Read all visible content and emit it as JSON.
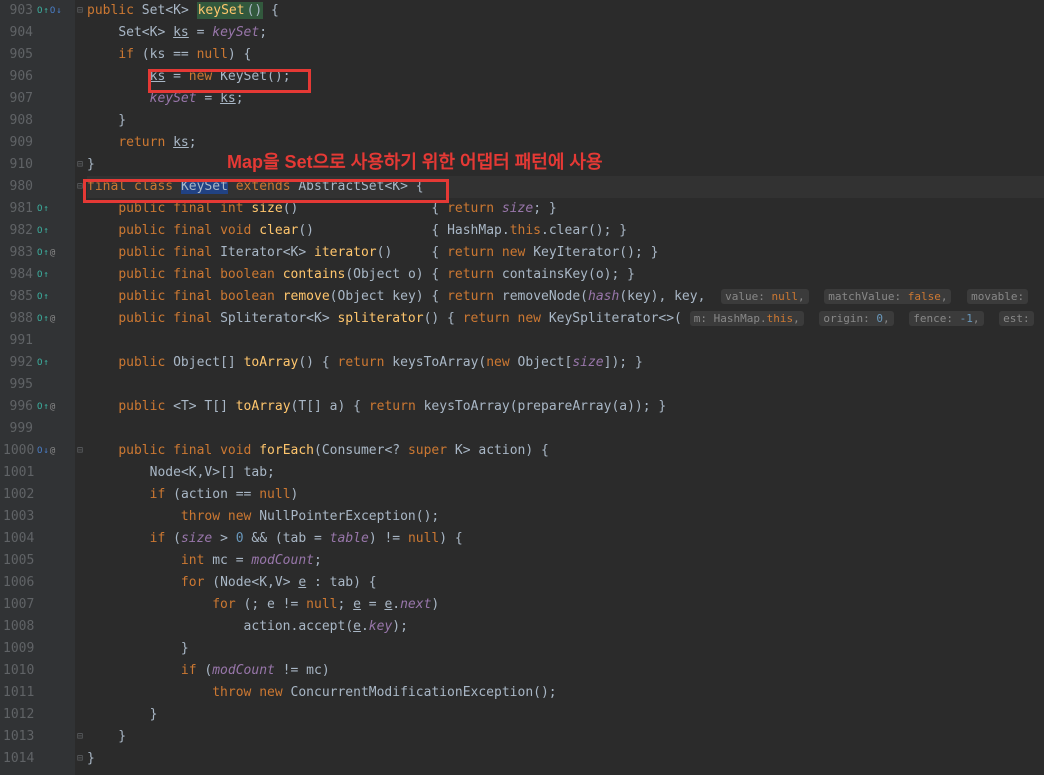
{
  "annotation": "Map을 Set으로 사용하기 위한 어댑터 패턴에 사용",
  "gutter": [
    {
      "n": "903",
      "markers": [
        "o-teal",
        "arrow-teal",
        "o-blue",
        "arrow-blue"
      ]
    },
    {
      "n": "904",
      "markers": []
    },
    {
      "n": "905",
      "markers": []
    },
    {
      "n": "906",
      "markers": []
    },
    {
      "n": "907",
      "markers": []
    },
    {
      "n": "908",
      "markers": []
    },
    {
      "n": "909",
      "markers": []
    },
    {
      "n": "910",
      "markers": []
    },
    {
      "n": "980",
      "markers": []
    },
    {
      "n": "981",
      "markers": [
        "o-teal",
        "arrow-teal"
      ]
    },
    {
      "n": "982",
      "markers": [
        "o-teal",
        "arrow-teal"
      ]
    },
    {
      "n": "983",
      "markers": [
        "o-teal",
        "arrow-teal",
        "at"
      ]
    },
    {
      "n": "984",
      "markers": [
        "o-teal",
        "arrow-teal"
      ]
    },
    {
      "n": "985",
      "markers": [
        "o-teal",
        "arrow-teal"
      ]
    },
    {
      "n": "988",
      "markers": [
        "o-teal",
        "arrow-teal",
        "at"
      ]
    },
    {
      "n": "991",
      "markers": []
    },
    {
      "n": "992",
      "markers": [
        "o-teal",
        "arrow-teal"
      ]
    },
    {
      "n": "995",
      "markers": []
    },
    {
      "n": "996",
      "markers": [
        "o-teal",
        "arrow-teal",
        "at"
      ]
    },
    {
      "n": "999",
      "markers": []
    },
    {
      "n": "1000",
      "markers": [
        "o-blue",
        "arrow-blue",
        "at"
      ]
    },
    {
      "n": "1001",
      "markers": []
    },
    {
      "n": "1002",
      "markers": []
    },
    {
      "n": "1003",
      "markers": []
    },
    {
      "n": "1004",
      "markers": []
    },
    {
      "n": "1005",
      "markers": []
    },
    {
      "n": "1006",
      "markers": []
    },
    {
      "n": "1007",
      "markers": []
    },
    {
      "n": "1008",
      "markers": []
    },
    {
      "n": "1009",
      "markers": []
    },
    {
      "n": "1010",
      "markers": []
    },
    {
      "n": "1011",
      "markers": []
    },
    {
      "n": "1012",
      "markers": []
    },
    {
      "n": "1013",
      "markers": []
    },
    {
      "n": "1014",
      "markers": []
    }
  ],
  "hints": {
    "value": "value:",
    "null": "null",
    "matchValue": "matchValue:",
    "false": "false",
    "movable": "movable:",
    "m": "m:",
    "origin": "origin:",
    "zero": "0",
    "fence": "fence:",
    "neg1": "-1",
    "est": "est:"
  },
  "t": {
    "public": "public",
    "final": "final",
    "class": "class",
    "extends": "extends",
    "return": "return",
    "new": "new",
    "if": "if",
    "for": "for",
    "throw": "throw",
    "null": "null",
    "void": "void",
    "int": "int",
    "boolean": "boolean",
    "super": "super",
    "this": "this",
    "Set": "Set",
    "KeySet": "KeySet",
    "AbstractSet": "AbstractSet",
    "Iterator": "Iterator",
    "Spliterator": "Spliterator",
    "Object": "Object",
    "Node": "Node",
    "Consumer": "Consumer",
    "HashMap": "HashMap",
    "NullPointerException": "NullPointerException",
    "ConcurrentModificationException": "ConcurrentModificationException",
    "KeyIterator": "KeyIterator",
    "KeySpliterator": "KeySpliterator",
    "K": "K",
    "V": "V",
    "T": "T",
    "keySet_fn": "keySet",
    "ks": "ks",
    "keySet_f": "keySet",
    "size": "size",
    "size_f": "size",
    "clear": "clear",
    "iterator_fn": "iterator",
    "contains": "contains",
    "containsKey": "containsKey",
    "remove": "remove",
    "removeNode": "removeNode",
    "hash": "hash",
    "key": "key",
    "spliterator": "spliterator",
    "toArray": "toArray",
    "keysToArray": "keysToArray",
    "prepareArray": "prepareArray",
    "forEach": "forEach",
    "action": "action",
    "tab": "tab",
    "table": "table",
    "mc": "mc",
    "modCount": "modCount",
    "e": "e",
    "next": "next",
    "accept": "accept",
    "o": "o",
    "a": "a",
    "zero": "0"
  }
}
